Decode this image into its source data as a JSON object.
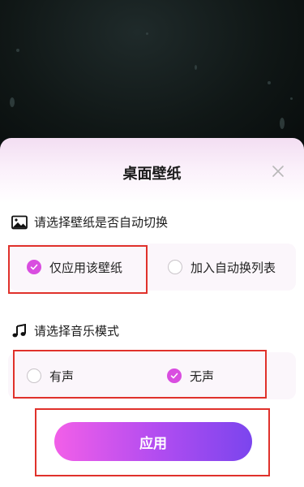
{
  "sheet": {
    "title": "桌面壁纸",
    "close_icon": "close-icon"
  },
  "wallpaper_section": {
    "heading": "请选择壁纸是否自动切换",
    "icon": "image-icon",
    "options": [
      {
        "label": "仅应用该壁纸",
        "checked": true
      },
      {
        "label": "加入自动换列表",
        "checked": false
      }
    ]
  },
  "music_section": {
    "heading": "请选择音乐模式",
    "icon": "music-note-icon",
    "options": [
      {
        "label": "有声",
        "checked": false
      },
      {
        "label": "无声",
        "checked": true
      }
    ]
  },
  "apply_button": {
    "label": "应用"
  },
  "colors": {
    "accent": "#d94de0",
    "button_gradient_start": "#f25fe8",
    "button_gradient_end": "#7b45ee",
    "highlight_box": "#e0312b"
  }
}
